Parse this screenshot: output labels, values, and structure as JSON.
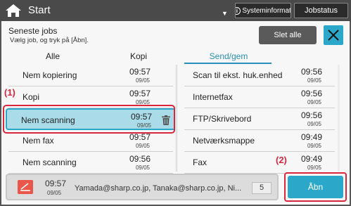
{
  "header": {
    "start_label": "Start",
    "caret": "▼",
    "sysinfo_label": "Systeminformat.",
    "jobstatus_label": "Jobstatus"
  },
  "panel": {
    "title": "Seneste jobs",
    "subtitle": "Vælg job, og tryk på [Åbn].",
    "clear_all": "Slet alle"
  },
  "tabs": [
    {
      "label": "Alle"
    },
    {
      "label": "Kopi"
    },
    {
      "label": "Send/gem"
    }
  ],
  "left_list": [
    {
      "name": "Nem kopiering",
      "time": "09:57",
      "date": "09/05"
    },
    {
      "name": "Kopi",
      "time": "09:57",
      "date": "09/05"
    },
    {
      "name": "Nem scanning",
      "time": "09:57",
      "date": "09/05",
      "selected": true
    },
    {
      "name": "Nem fax",
      "time": "09:57",
      "date": "09/05"
    },
    {
      "name": "Nem scanning",
      "time": "09:56",
      "date": "09/05"
    }
  ],
  "right_list": [
    {
      "name": "Scan til ekst. huk.enhed",
      "time": "09:56",
      "date": "09/05"
    },
    {
      "name": "Internetfax",
      "time": "09:56",
      "date": "09/05"
    },
    {
      "name": "FTP/Skrivebord",
      "time": "09:56",
      "date": "09/05"
    },
    {
      "name": "Netværksmappe",
      "time": "09:49",
      "date": "09/05"
    },
    {
      "name": "Fax",
      "time": "09:49",
      "date": "09/05"
    }
  ],
  "markers": {
    "m1": "(1)",
    "m2": "(2)"
  },
  "selected_job": {
    "time": "09:57",
    "date": "09/05",
    "addresses": "Yamada@sharp.co.jp, Tanaka@sharp.co.jp, Ni...",
    "count": "5"
  },
  "open_button": "Åbn",
  "colors": {
    "accent": "#2aa7c9",
    "topbar": "#4a4a4a",
    "marker": "#d7263d",
    "selected_row": "#a9dce8"
  }
}
